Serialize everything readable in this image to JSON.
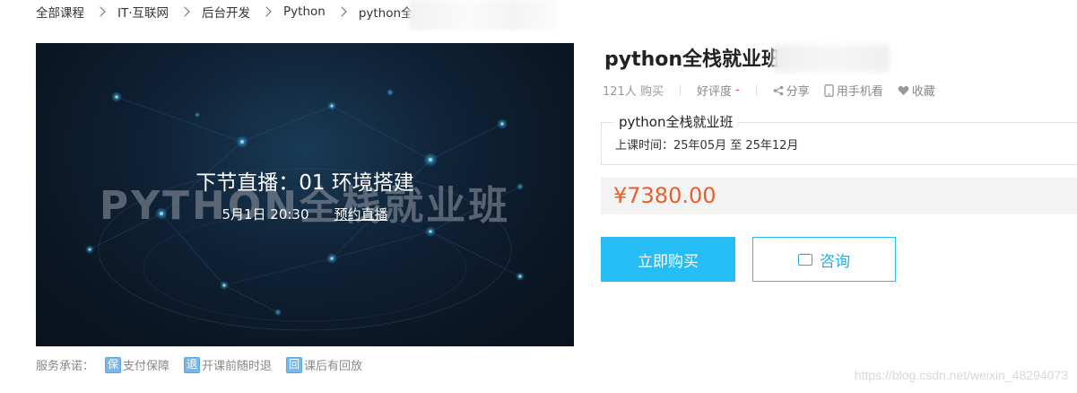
{
  "breadcrumb": {
    "items": [
      "全部课程",
      "IT·互联网",
      "后台开发",
      "Python",
      "python全"
    ]
  },
  "banner": {
    "watermark": "PYTHON全栈就业班",
    "live_title": "下节直播：01 环境搭建",
    "live_time": "5月1日 20:30",
    "reserve_link": "预约直播"
  },
  "service": {
    "label": "服务承诺：",
    "items": [
      {
        "icon_char": "保",
        "text": "支付保障"
      },
      {
        "icon_char": "退",
        "text": "开课前随时退"
      },
      {
        "icon_char": "回",
        "text": "课后有回放"
      }
    ]
  },
  "course": {
    "title": "python全栈就业班",
    "buyers": "121人 购买",
    "rating_label": "好评度",
    "rating_value": "-",
    "share": "分享",
    "mobile": "用手机看",
    "favorite": "收藏"
  },
  "class_info": {
    "name": "python全栈就业班",
    "schedule": "上课时间：25年05月 至 25年12月"
  },
  "price": "¥7380.00",
  "actions": {
    "buy": "立即购买",
    "consult": "咨询"
  },
  "watermark": "https://blog.csdn.net/weixin_48294073",
  "colors": {
    "accent": "#26bdf6",
    "price": "#e8602c"
  }
}
